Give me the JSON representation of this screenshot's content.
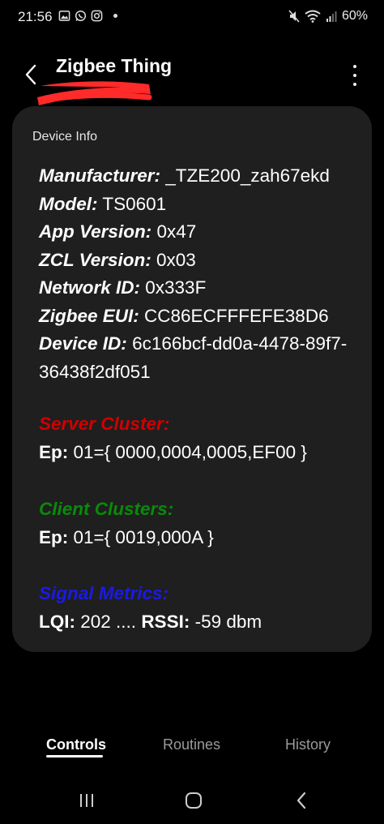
{
  "status_bar": {
    "time": "21:56",
    "battery": "60%"
  },
  "header": {
    "title": "Zigbee Thing"
  },
  "card": {
    "label": "Device Info",
    "fields": [
      {
        "key": "Manufacturer:",
        "value": " _TZE200_zah67ekd"
      },
      {
        "key": "Model:",
        "value": " TS0601"
      },
      {
        "key": "App Version:",
        "value": " 0x47"
      },
      {
        "key": "ZCL Version:",
        "value": " 0x03"
      },
      {
        "key": "Network ID:",
        "value": " 0x333F"
      },
      {
        "key": "Zigbee EUI:",
        "value": " CC86ECFFFEFE38D6"
      },
      {
        "key": "Device ID:",
        "value": " 6c166bcf-dd0a-4478-89f7-36438f2df051"
      }
    ],
    "server_cluster": {
      "heading": "Server Cluster:",
      "key": "Ep:",
      "value": " 01={ 0000,0004,0005,EF00 }"
    },
    "client_clusters": {
      "heading": "Client Clusters:",
      "key": "Ep:",
      "value": " 01={ 0019,000A }"
    },
    "signal_metrics": {
      "heading": "Signal Metrics:",
      "lqi_key": "LQI:",
      "lqi_value": " 202 .... ",
      "rssi_key": "RSSI:",
      "rssi_value": " -59 dbm"
    }
  },
  "colors": {
    "server": "#d00000",
    "client": "#0a8a0a",
    "signal": "#1a1ae6",
    "redaction": "#ff2a2a"
  },
  "tabs": [
    {
      "label": "Controls",
      "active": true
    },
    {
      "label": "Routines",
      "active": false
    },
    {
      "label": "History",
      "active": false
    }
  ],
  "icons": {
    "back": "chevron-left-icon",
    "menu": "more-vertical-icon",
    "nav_recents": "recents-icon",
    "nav_home": "home-icon",
    "nav_back": "back-icon"
  }
}
